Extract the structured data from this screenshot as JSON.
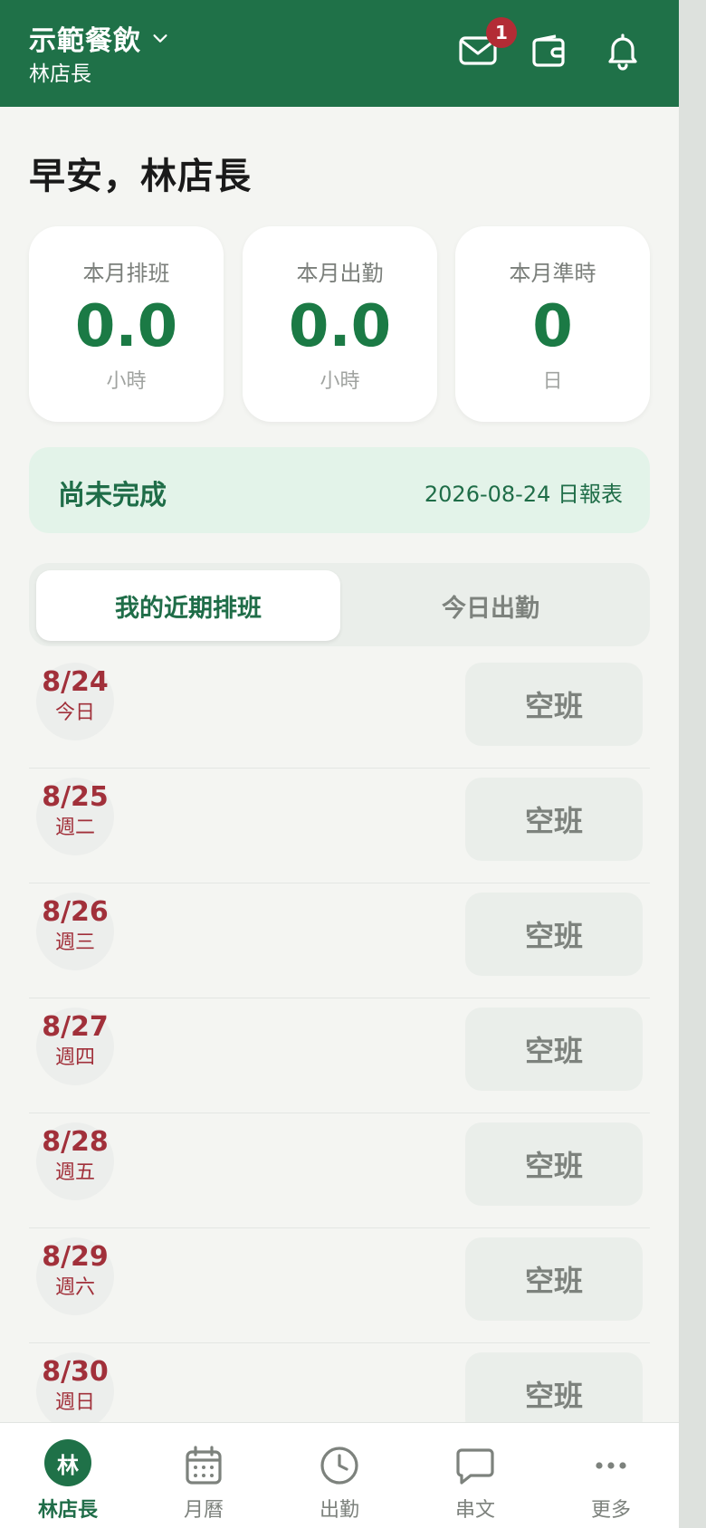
{
  "header": {
    "org_name": "示範餐飲",
    "user_role": "林店長",
    "unread_mail_count": "1"
  },
  "greeting": "早安，林店長",
  "stats": [
    {
      "label": "本月排班",
      "value": "0.0",
      "unit": "小時"
    },
    {
      "label": "本月出勤",
      "value": "0.0",
      "unit": "小時"
    },
    {
      "label": "本月準時",
      "value": "0",
      "unit": "日"
    }
  ],
  "report": {
    "status": "尚未完成",
    "date_label": "2026-08-24 日報表"
  },
  "tabs": [
    {
      "label": "我的近期排班",
      "active": true
    },
    {
      "label": "今日出勤",
      "active": false
    }
  ],
  "schedule": [
    {
      "date": "8/24",
      "dow": "今日",
      "shift": "空班"
    },
    {
      "date": "8/25",
      "dow": "週二",
      "shift": "空班"
    },
    {
      "date": "8/26",
      "dow": "週三",
      "shift": "空班"
    },
    {
      "date": "8/27",
      "dow": "週四",
      "shift": "空班"
    },
    {
      "date": "8/28",
      "dow": "週五",
      "shift": "空班"
    },
    {
      "date": "8/29",
      "dow": "週六",
      "shift": "空班"
    },
    {
      "date": "8/30",
      "dow": "週日",
      "shift": "空班"
    }
  ],
  "bottom_nav": [
    {
      "label": "林店長",
      "icon": "avatar",
      "avatar_text": "林",
      "active": true
    },
    {
      "label": "月曆",
      "icon": "calendar-icon",
      "active": false
    },
    {
      "label": "出勤",
      "icon": "clock-icon",
      "active": false
    },
    {
      "label": "串文",
      "icon": "chat-icon",
      "active": false
    },
    {
      "label": "更多",
      "icon": "more-icon",
      "active": false
    }
  ],
  "colors": {
    "brand_green": "#1f7148",
    "accent_green": "#1b7a45",
    "date_red": "#a1303a",
    "badge_red": "#b32c35"
  }
}
